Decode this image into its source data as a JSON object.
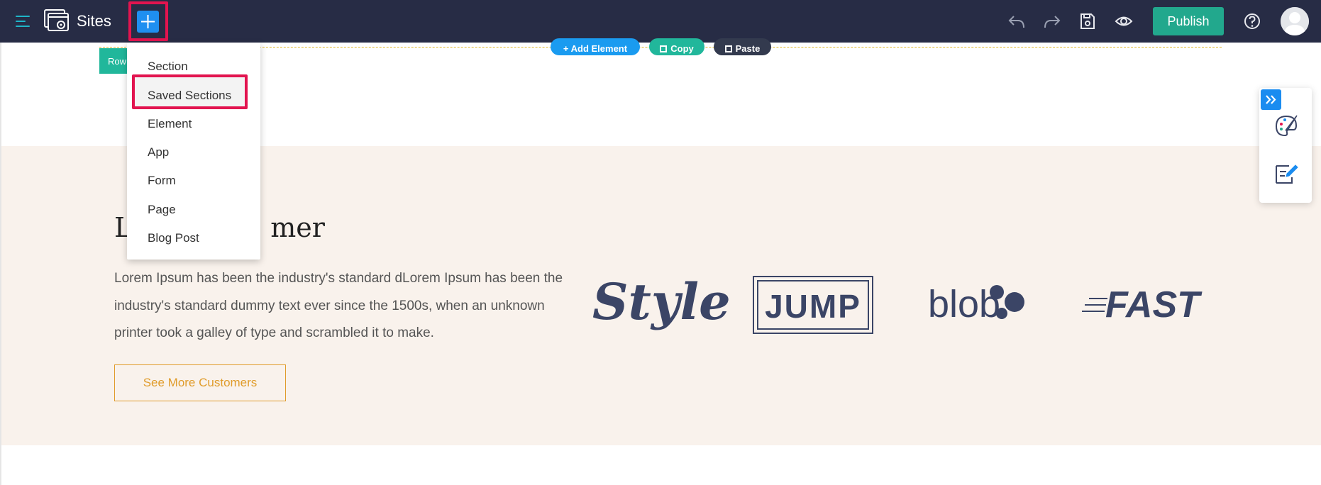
{
  "app": {
    "title": "Sites"
  },
  "toolbar": {
    "add_icon": "plus-icon",
    "undo_icon": "undo-icon",
    "redo_icon": "redo-icon",
    "save_icon": "save-icon",
    "preview_icon": "eye-icon",
    "publish_label": "Publish",
    "help_icon": "help-icon",
    "accent": "#22a88d",
    "bar_color": "#272c45"
  },
  "add_menu": {
    "items": [
      {
        "label": "Section"
      },
      {
        "label": "Saved Sections"
      },
      {
        "label": "Element"
      },
      {
        "label": "App"
      },
      {
        "label": "Form"
      },
      {
        "label": "Page"
      },
      {
        "label": "Blog Post"
      }
    ],
    "highlighted": "Saved Sections",
    "highlight_color": "#e2144f"
  },
  "row_actions": {
    "row_label": "Row",
    "add_element": "+ Add Element",
    "copy": "Copy",
    "paste": "Paste"
  },
  "section": {
    "heading_visible": "mer",
    "heading_initial": "L",
    "paragraph": "Lorem Ipsum has been the industry's standard dLorem Ipsum has been the industry's standard dummy text ever since the 1500s, when an unknown printer took a galley of type and scrambled it to make.",
    "button_label": "See More Customers",
    "background": "#f9f2ec",
    "button_color": "#e09c2b"
  },
  "logos": {
    "style": "Style",
    "jump": "JUMP",
    "blob": "blob",
    "fast": "FAST"
  },
  "right_panel": {
    "expand_icon": "double-chevron-right-icon",
    "icons": [
      "palette-brush-icon",
      "edit-note-icon"
    ]
  }
}
